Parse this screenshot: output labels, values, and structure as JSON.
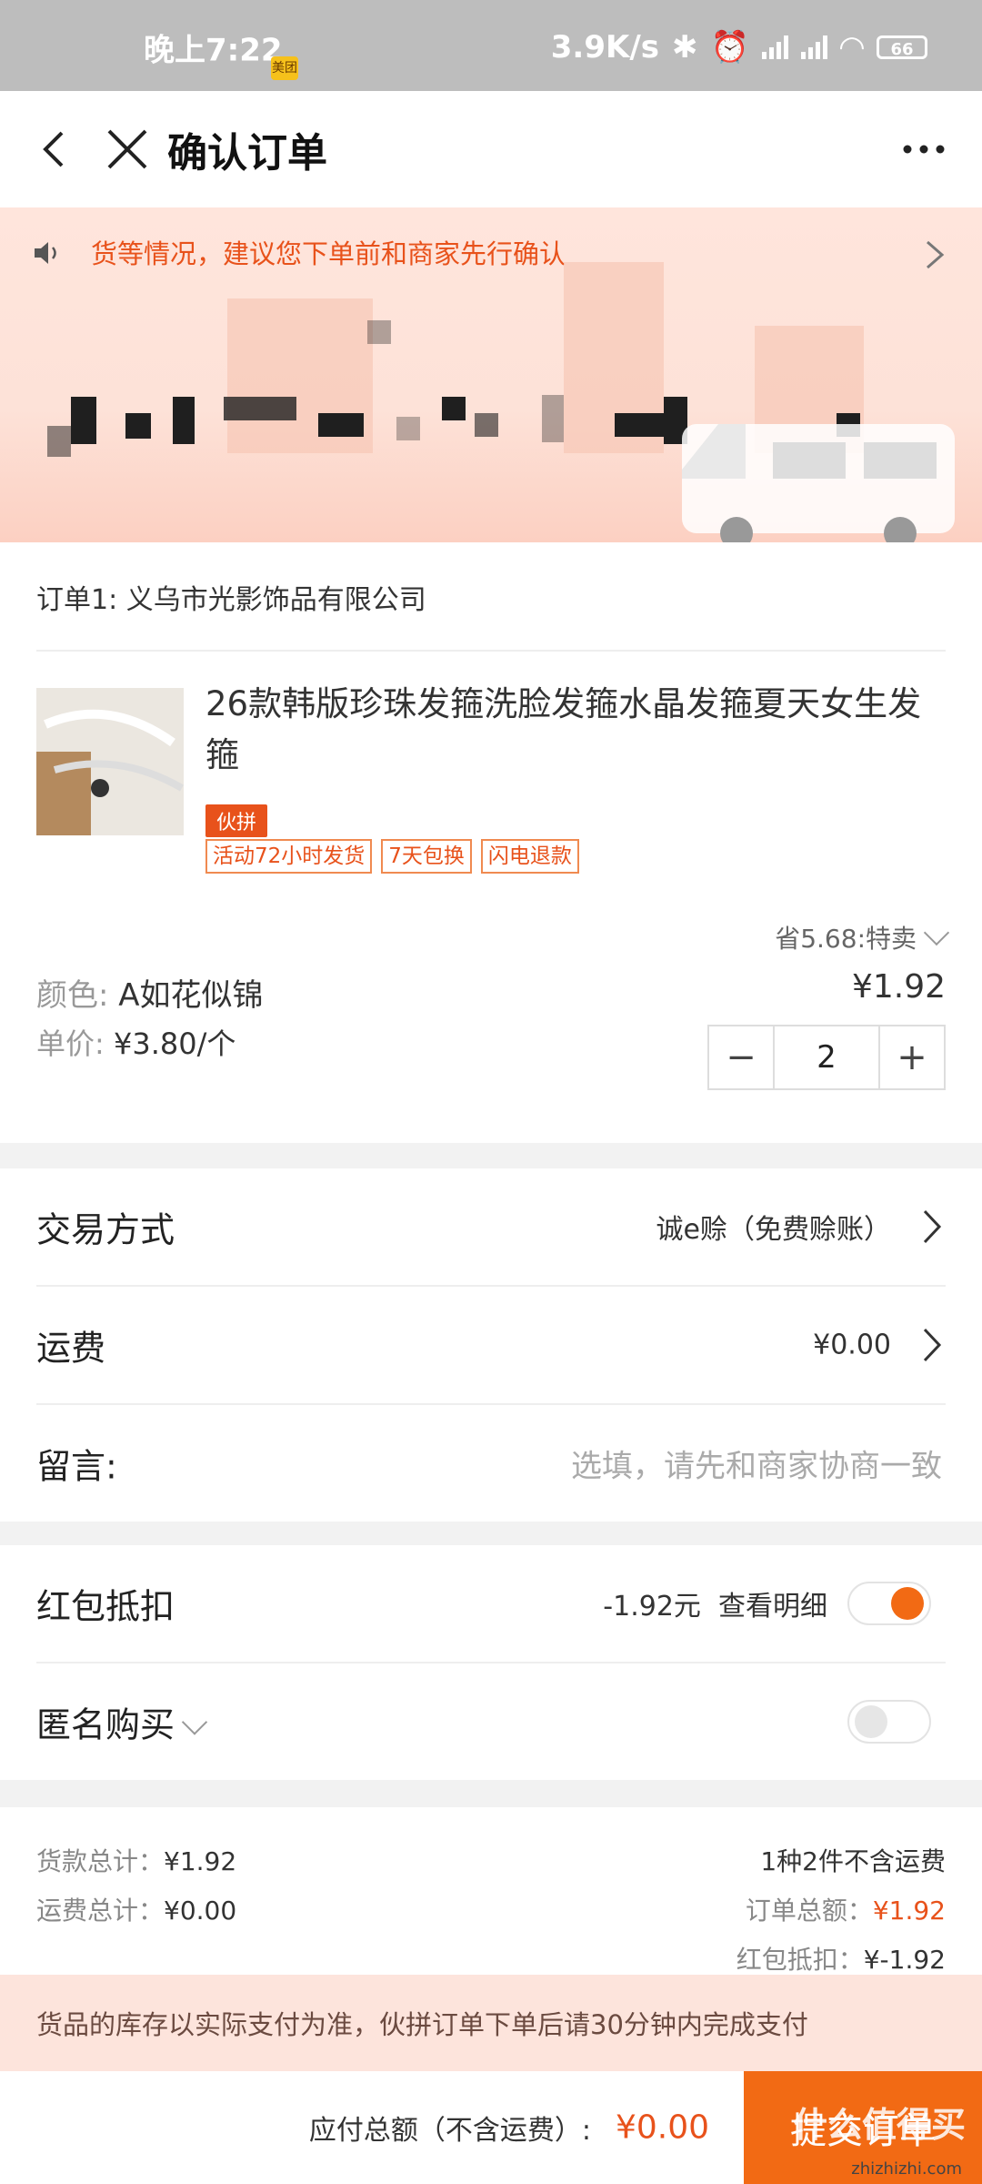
{
  "status_bar": {
    "time": "晚上7:22",
    "app_badge": "美团",
    "speed": "3.9K/s",
    "battery": "66"
  },
  "header": {
    "title": "确认订单"
  },
  "notice": {
    "text": "货等情况，建议您下单前和商家先行确认"
  },
  "order": {
    "shop": "订单1: 义乌市光影饰品有限公司",
    "product_title": "26款韩版珍珠发箍洗脸发箍水晶发箍夏天女生发箍",
    "tag_group": "伙拼",
    "tags": [
      "活动72小时发货",
      "7天包换",
      "闪电退款"
    ],
    "save_text": "省5.68:特卖",
    "color_label": "颜色:",
    "color_value": "A如花似锦",
    "price": "¥1.92",
    "unit_label": "单价:",
    "unit_value": "¥3.80/个",
    "quantity": "2",
    "minus": "−",
    "plus": "+"
  },
  "rows": {
    "trade_label": "交易方式",
    "trade_value": "诚e赊（免费赊账）",
    "shipping_label": "运费",
    "shipping_value": "¥0.00",
    "message_label": "留言:",
    "message_placeholder": "选填，请先和商家协商一致"
  },
  "rows2": {
    "redpacket_label": "红包抵扣",
    "redpacket_value": "-1.92元",
    "redpacket_detail": "查看明细",
    "redpacket_on": true,
    "anon_label": "匿名购买",
    "anon_on": false
  },
  "summary": {
    "goods_total_label": "货款总计：",
    "goods_total": "¥1.92",
    "freight_total_label": "运费总计：",
    "freight_total": "¥0.00",
    "count_text": "1种2件不含运费",
    "order_total_label": "订单总额：",
    "order_total": "¥1.92",
    "redpacket_label": "红包抵扣：",
    "redpacket": "¥-1.92"
  },
  "stock_note": "货品的库存以实际支付为准，伙拼订单下单后请30分钟内完成支付",
  "footer": {
    "pay_label": "应付总额（不含运费）:",
    "pay_amount": "¥0.00",
    "submit": "提交订单",
    "watermark": "什么值得买",
    "watermark_url": "zhizhizhi.com"
  },
  "colors": {
    "accent": "#f26a14",
    "notice": "#e8521b"
  }
}
